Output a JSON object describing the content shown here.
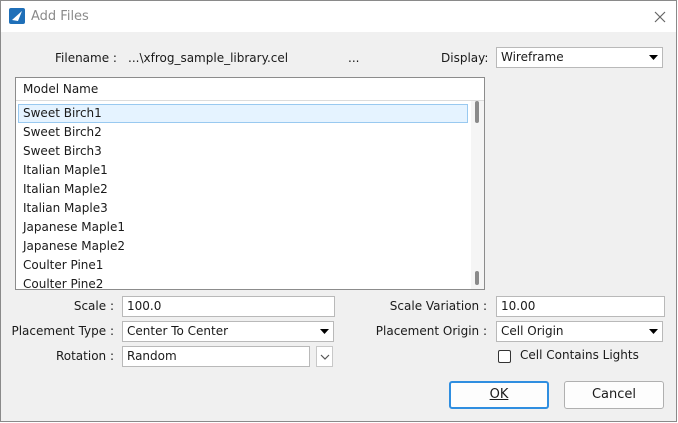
{
  "window": {
    "title": "Add Files"
  },
  "filename": {
    "label": "Filename :",
    "value": "...\\xfrog_sample_library.cel",
    "browse_label": "..."
  },
  "display": {
    "label": "Display:",
    "value": "Wireframe"
  },
  "model_list": {
    "header": "Model Name",
    "items": [
      "Sweet Birch1",
      "Sweet Birch2",
      "Sweet Birch3",
      "Italian Maple1",
      "Italian Maple2",
      "Italian Maple3",
      "Japanese Maple1",
      "Japanese Maple2",
      "Coulter Pine1",
      "Coulter Pine2"
    ],
    "selected_index": 0
  },
  "scale": {
    "label": "Scale :",
    "value": "100.0"
  },
  "scale_variation": {
    "label": "Scale Variation :",
    "value": "10.00"
  },
  "placement_type": {
    "label": "Placement Type :",
    "value": "Center To Center"
  },
  "placement_origin": {
    "label": "Placement Origin :",
    "value": "Cell Origin"
  },
  "rotation": {
    "label": "Rotation :",
    "value": "Random"
  },
  "cell_contains_lights": {
    "label": "Cell Contains Lights",
    "checked": false
  },
  "buttons": {
    "ok": "OK",
    "cancel": "Cancel"
  },
  "colors": {
    "selection": "#e5f3ff",
    "ok_border": "#2f8ee0",
    "arrow": "#e00000"
  }
}
